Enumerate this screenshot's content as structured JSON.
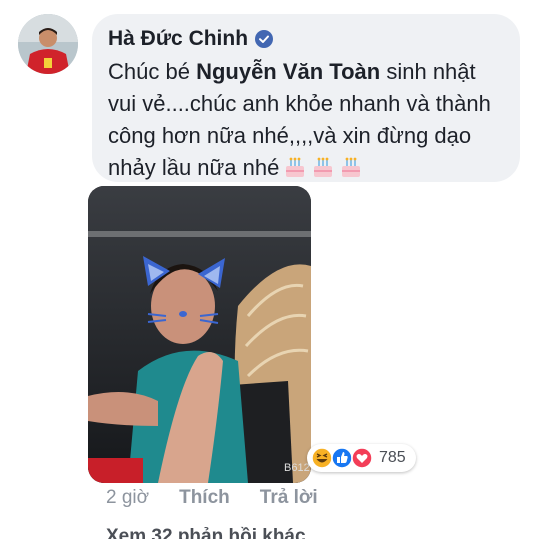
{
  "comment": {
    "author": "Hà Đức Chinh",
    "text_before_mention": "Chúc bé ",
    "mention": "Nguyễn Văn Toàn",
    "text_after_mention": " sinh nhật vui vẻ....chúc anh khỏe nhanh và thành công hơn nữa nhé,,,,và xin đừng dạo nhảy lầu nữa nhé",
    "emoji": [
      "birthday-cake-icon",
      "birthday-cake-icon",
      "birthday-cake-icon"
    ],
    "media_label": "B612"
  },
  "reactions": {
    "icons": [
      "haha-icon",
      "like-icon",
      "love-icon"
    ],
    "count": "785"
  },
  "actions": {
    "time": "2 giờ",
    "like": "Thích",
    "reply": "Trả lời"
  },
  "more_replies": "Xem 32 phản hồi khác",
  "colors": {
    "bubble": "#eff1f4",
    "text": "#1d2129",
    "meta": "#8d949e",
    "verified": "#4267b2",
    "like": "#1877f2",
    "love": "#f33e58",
    "haha": "#f7b125"
  }
}
